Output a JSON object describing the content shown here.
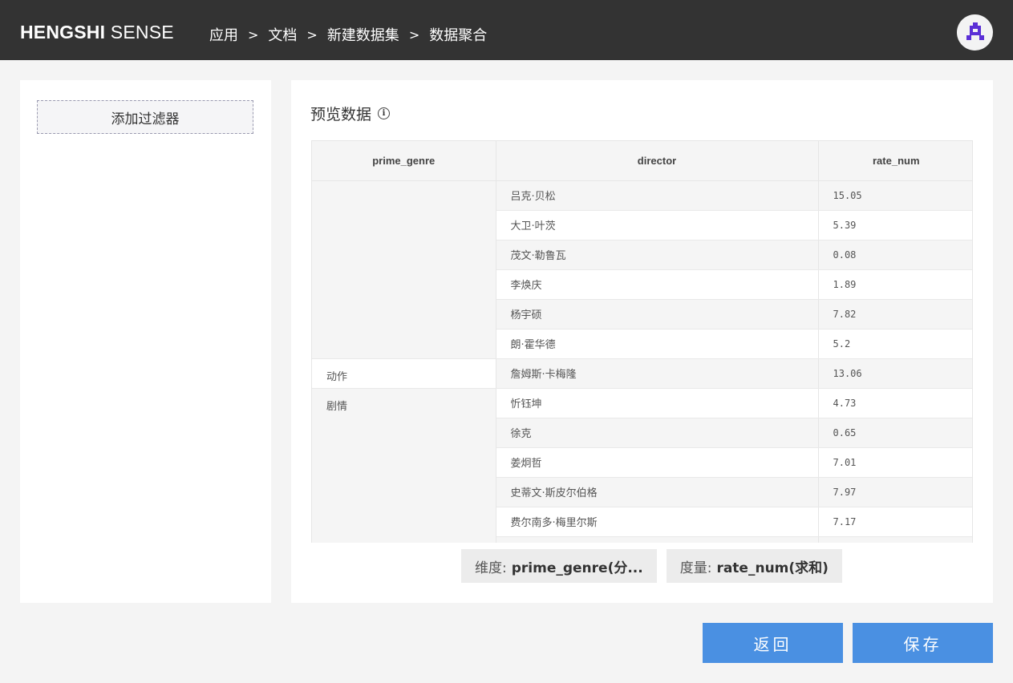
{
  "header": {
    "brand_bold": "HENGSHI",
    "brand_light": "SENSE",
    "breadcrumb": [
      "应用",
      "文档",
      "新建数据集",
      "数据聚合"
    ],
    "separator": ">"
  },
  "sidebar": {
    "add_filter_label": "添加过滤器"
  },
  "main": {
    "title": "预览数据",
    "info_icon": "i",
    "columns": [
      "prime_genre",
      "director",
      "rate_num"
    ],
    "rows": [
      {
        "genre": "",
        "director": "吕克·贝松",
        "rate": "15.05"
      },
      {
        "genre": "",
        "director": "大卫·叶茨",
        "rate": "5.39"
      },
      {
        "genre": "",
        "director": "茂文·勒鲁瓦",
        "rate": "0.08"
      },
      {
        "genre": "",
        "director": "李焕庆",
        "rate": "1.89"
      },
      {
        "genre": "",
        "director": "杨宇硕",
        "rate": "7.82"
      },
      {
        "genre": "",
        "director": "朗·霍华德",
        "rate": "5.2"
      },
      {
        "genre": "动作",
        "director": "詹姆斯·卡梅隆",
        "rate": "13.06"
      },
      {
        "genre": "剧情",
        "director": "忻钰坤",
        "rate": "4.73"
      },
      {
        "genre": "",
        "director": "徐克",
        "rate": "0.65"
      },
      {
        "genre": "",
        "director": "姜炯哲",
        "rate": "7.01"
      },
      {
        "genre": "",
        "director": "史蒂文·斯皮尔伯格",
        "rate": "7.97"
      },
      {
        "genre": "",
        "director": "费尔南多·梅里尔斯",
        "rate": "7.17"
      },
      {
        "genre": "",
        "director": "",
        "rate": ""
      }
    ],
    "chips": [
      {
        "label": "维度:",
        "value": "prime_genre(分..."
      },
      {
        "label": "度量:",
        "value": "rate_num(求和)"
      }
    ]
  },
  "footer": {
    "back_label": "返回",
    "save_label": "保存"
  },
  "colors": {
    "topbar": "#333333",
    "accent": "#4a90e2",
    "avatar_icon": "#5b2fd6"
  }
}
